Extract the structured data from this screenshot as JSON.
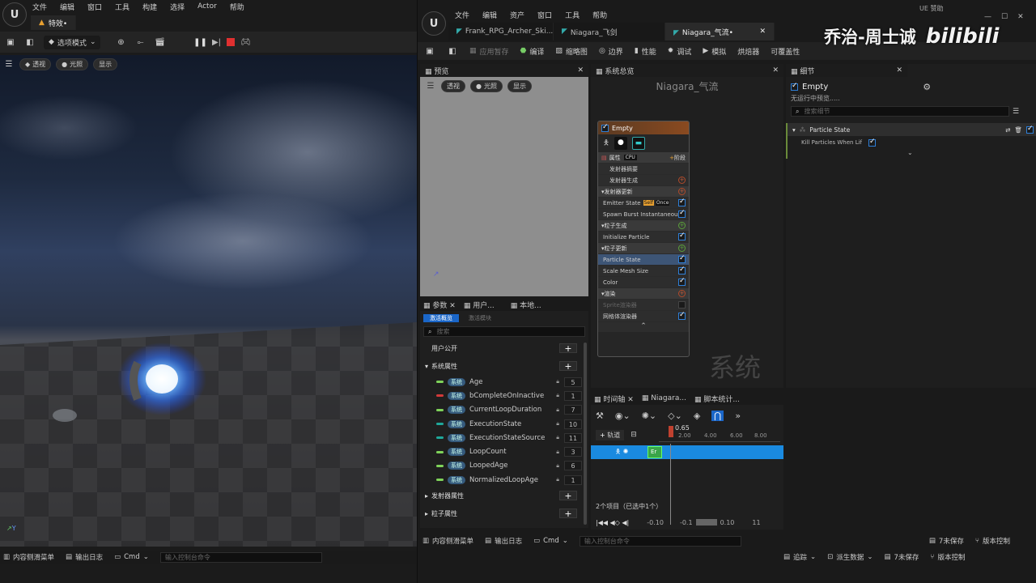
{
  "left_editor": {
    "menu": [
      "文件",
      "编辑",
      "窗口",
      "工具",
      "构建",
      "选择",
      "Actor",
      "帮助"
    ],
    "tab_title": "特效•",
    "mode_button": "选项模式",
    "viewport_buttons": [
      "透视",
      "光照",
      "显示"
    ],
    "status_bar": {
      "content_drawer": "内容侧滑菜单",
      "output_log": "输出日志",
      "cmd": "Cmd",
      "console_placeholder": "输入控制台命令"
    }
  },
  "niagara": {
    "menu": [
      "文件",
      "编辑",
      "资产",
      "窗口",
      "工具",
      "帮助"
    ],
    "tabs": [
      "Frank_RPG_Archer_Ski...",
      "Niagara_飞剑",
      "Niagara_气流•"
    ],
    "toolbar": [
      "应用暂存",
      "编译",
      "缩略图",
      "边界",
      "性能",
      "调试",
      "模拟",
      "烘焙器",
      "可覆盖性"
    ],
    "preview": {
      "title": "预览",
      "buttons": [
        "透视",
        "光照",
        "显示"
      ]
    },
    "system_overview": {
      "title": "系统总览",
      "graph_title": "Niagara_气流",
      "watermark": "系统",
      "emitter": {
        "name": "Empty",
        "props_label": "属性",
        "cpu": "CPU",
        "stage_label": "阶段",
        "rows": [
          {
            "label": "发射器摘要",
            "type": "plain"
          },
          {
            "label": "发射器生成",
            "type": "plain-r"
          },
          {
            "label": "发射器更新",
            "type": "hdr-r"
          },
          {
            "label": "Emitter State",
            "type": "item",
            "extra1": "Self",
            "extra2": "Once"
          },
          {
            "label": "Spawn Burst Instantaneous",
            "type": "item"
          },
          {
            "label": "粒子生成",
            "type": "hdr-g"
          },
          {
            "label": "Initialize Particle",
            "type": "item"
          },
          {
            "label": "粒子更新",
            "type": "hdr-g"
          },
          {
            "label": "Particle State",
            "type": "sel"
          },
          {
            "label": "Scale Mesh Size",
            "type": "item"
          },
          {
            "label": "Color",
            "type": "item"
          },
          {
            "label": "渲染",
            "type": "hdr-r"
          },
          {
            "label": "Sprite渲染器",
            "type": "dim"
          },
          {
            "label": "网格体渲染器",
            "type": "item"
          }
        ]
      }
    },
    "params": {
      "tabs": [
        "参数",
        "用户...",
        "本地..."
      ],
      "subtabs": [
        "激活概览",
        "激活模块"
      ],
      "search_placeholder": "搜索",
      "user_public": "用户公开",
      "system_attrs": "系统属性",
      "items": [
        {
          "tag": "系统",
          "name": "Age",
          "value": "5",
          "color": "#7fd35a"
        },
        {
          "tag": "系统",
          "name": "bCompleteOnInactive",
          "value": "1",
          "color": "#d23a3a"
        },
        {
          "tag": "系统",
          "name": "CurrentLoopDuration",
          "value": "7",
          "color": "#7fd35a"
        },
        {
          "tag": "系统",
          "name": "ExecutionState",
          "value": "10",
          "color": "#1fa89a"
        },
        {
          "tag": "系统",
          "name": "ExecutionStateSource",
          "value": "11",
          "color": "#1fa89a"
        },
        {
          "tag": "系统",
          "name": "LoopCount",
          "value": "3",
          "color": "#7fd35a"
        },
        {
          "tag": "系统",
          "name": "LoopedAge",
          "value": "6",
          "color": "#7fd35a"
        },
        {
          "tag": "系统",
          "name": "NormalizedLoopAge",
          "value": "1",
          "color": "#7fd35a"
        }
      ],
      "emitter_attrs": "发射器属性",
      "particle_attrs": "粒子属性"
    },
    "details": {
      "title": "细节",
      "name": "Empty",
      "subtitle": "无运行中预览.....",
      "search_placeholder": "搜索细节",
      "section": "Particle State",
      "prop": "Kill Particles When Lif"
    },
    "timeline": {
      "tabs": [
        "时间轴",
        "Niagara...",
        "脚本统计..."
      ],
      "add_track": "轨道",
      "current_time": "0.65",
      "ticks": [
        "2.00",
        "4.00",
        "6.00",
        "8.00"
      ],
      "track_label": "Er",
      "items_status": "2个项目（已选中1个）",
      "range_start": "-0.10",
      "range_a": "-0.1",
      "range_b": "0.10",
      "range_end": "11"
    },
    "status_bar": {
      "content_drawer": "内容侧滑菜单",
      "output_log": "输出日志",
      "cmd": "Cmd",
      "console_placeholder": "输入控制台命令",
      "unsaved": "7未保存",
      "source_control": "版本控制",
      "trace": "追踪",
      "derived": "派生数据"
    },
    "header_right": "UE 赞助"
  },
  "overlay": {
    "creator": "乔治-周士诚",
    "brand": "bilibili"
  }
}
